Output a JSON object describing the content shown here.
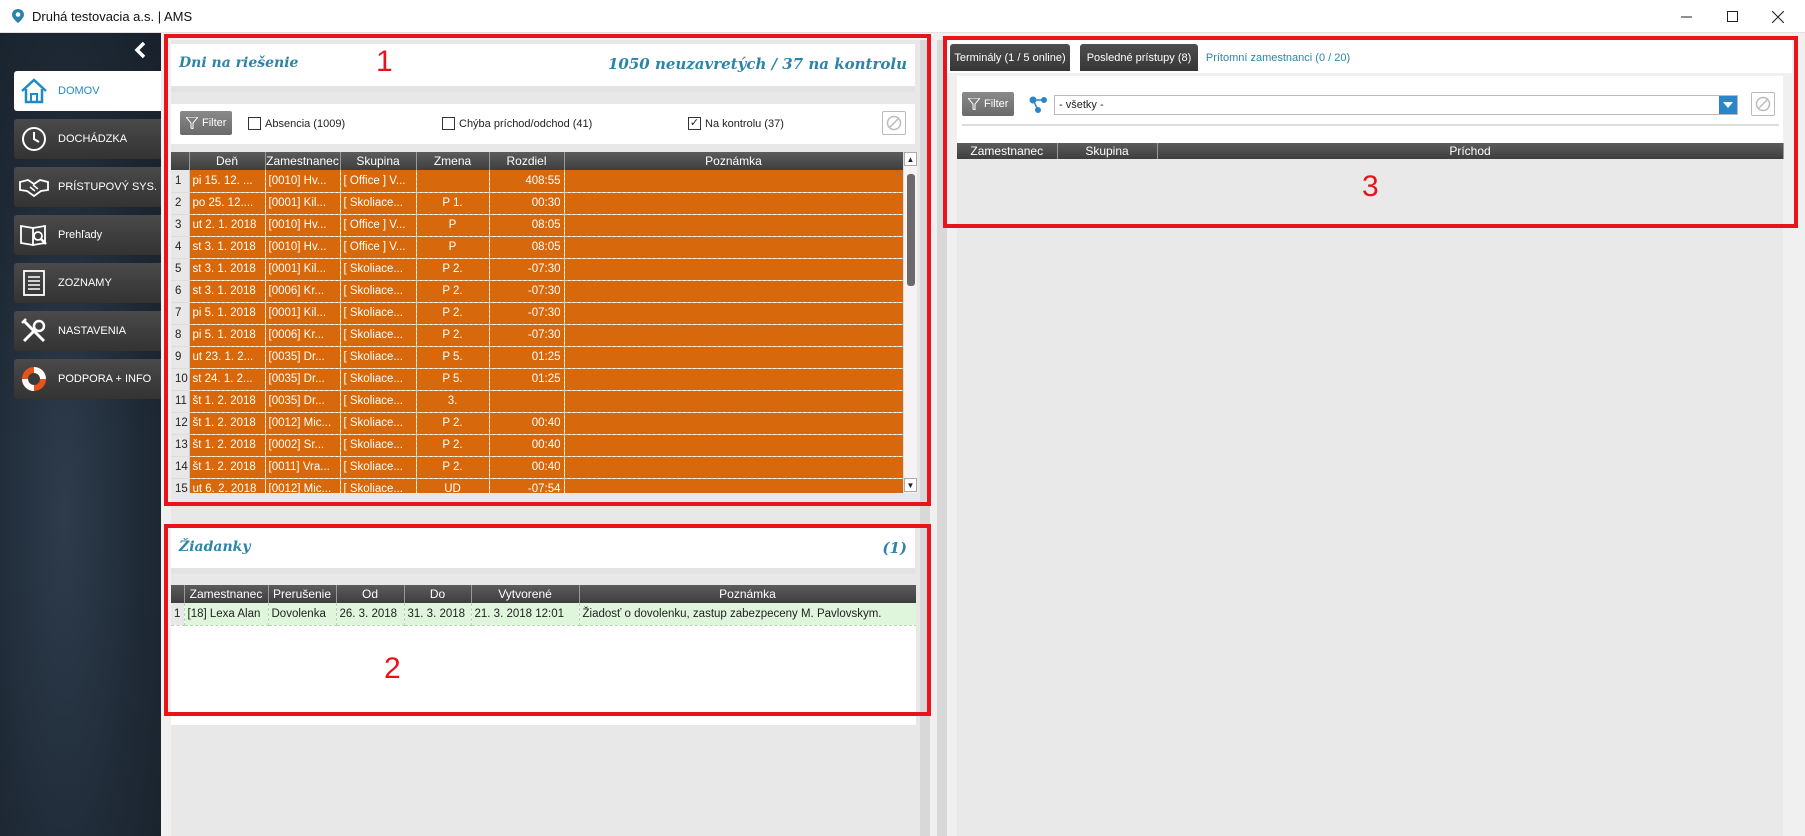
{
  "window": {
    "title": "Druhá testovacia a.s. | AMS"
  },
  "sidebar": {
    "items": [
      {
        "label": "DOMOV",
        "icon": "home-icon"
      },
      {
        "label": "DOCHÁDZKA",
        "icon": "clock-icon"
      },
      {
        "label": "PRÍSTUPOVÝ SYS.",
        "icon": "handshake-icon"
      },
      {
        "label": "Prehľady",
        "icon": "book-search-icon"
      },
      {
        "label": "ZOZNAMY",
        "icon": "list-icon"
      },
      {
        "label": "NASTAVENIA",
        "icon": "tools-icon"
      },
      {
        "label": "PODPORA + INFO",
        "icon": "lifebuoy-icon"
      }
    ]
  },
  "panel1": {
    "title": "Dni na riešenie",
    "count": "1050 neuzavretých / 37 na kontrolu",
    "filter_label": "Filter",
    "checkboxes": [
      {
        "label": "Absencia (1009)",
        "checked": false
      },
      {
        "label": "Chýba príchod/odchod (41)",
        "checked": false
      },
      {
        "label": "Na kontrolu (37)",
        "checked": true
      }
    ],
    "columns": [
      "Deň",
      "Zamestnanec",
      "Skupina",
      "Zmena",
      "Rozdiel",
      "Poznámka"
    ],
    "rows": [
      [
        "1",
        "pi 15. 12. ...",
        "[0010] Hv...",
        "[ Office ]  V...",
        "",
        "408:55",
        ""
      ],
      [
        "2",
        "po 25. 12....",
        "[0001] Kil...",
        "[ Skoliace...",
        "P 1.",
        "00:30",
        ""
      ],
      [
        "3",
        "ut 2. 1. 2018",
        "[0010] Hv...",
        "[ Office ]  V...",
        "P",
        "08:05",
        ""
      ],
      [
        "4",
        "st 3. 1. 2018",
        "[0010] Hv...",
        "[ Office ]  V...",
        "P",
        "08:05",
        ""
      ],
      [
        "5",
        "st 3. 1. 2018",
        "[0001] Kil...",
        "[ Skoliace...",
        "P 2.",
        "-07:30",
        ""
      ],
      [
        "6",
        "st 3. 1. 2018",
        "[0006] Kr...",
        "[ Skoliace...",
        "P 2.",
        "-07:30",
        ""
      ],
      [
        "7",
        "pi 5. 1. 2018",
        "[0001] Kil...",
        "[ Skoliace...",
        "P 2.",
        "-07:30",
        ""
      ],
      [
        "8",
        "pi 5. 1. 2018",
        "[0006] Kr...",
        "[ Skoliace...",
        "P 2.",
        "-07:30",
        ""
      ],
      [
        "9",
        "ut 23. 1. 2...",
        "[0035] Dr...",
        "[ Skoliace...",
        "P 5.",
        "01:25",
        ""
      ],
      [
        "10",
        "st 24. 1. 2...",
        "[0035] Dr...",
        "[ Skoliace...",
        "P 5.",
        "01:25",
        ""
      ],
      [
        "11",
        "št 1. 2. 2018",
        "[0035] Dr...",
        "[ Skoliace...",
        "3.",
        "",
        ""
      ],
      [
        "12",
        "št 1. 2. 2018",
        "[0012] Mic...",
        "[ Skoliace...",
        "P 2.",
        "00:40",
        ""
      ],
      [
        "13",
        "št 1. 2. 2018",
        "[0002] Sr...",
        "[ Skoliace...",
        "P 2.",
        "00:40",
        ""
      ],
      [
        "14",
        "št 1. 2. 2018",
        "[0011] Vra...",
        "[ Skoliace...",
        "P 2.",
        "00:40",
        ""
      ],
      [
        "15",
        "ut 6. 2. 2018",
        "[0012] Mic...",
        "[ Skoliace...",
        "UD",
        "-07:54",
        ""
      ]
    ]
  },
  "panel2": {
    "title": "Žiadanky",
    "count": "(1)",
    "columns": [
      "Zamestnanec",
      "Prerušenie",
      "Od",
      "Do",
      "Vytvorené",
      "Poznámka"
    ],
    "rows": [
      [
        "1",
        "[18] Lexa Alan",
        "Dovolenka",
        "26. 3. 2018",
        "31. 3. 2018",
        "21. 3. 2018  12:01",
        "Žiadosť o dovolenku, zastup zabezpeceny M. Pavlovskym."
      ]
    ]
  },
  "panel3": {
    "tabs": [
      {
        "label": "Terminály (1 / 5 online)",
        "active": false
      },
      {
        "label": "Posledné prístupy (8)",
        "active": false
      },
      {
        "label": "Prítomní zamestnanci (0 / 20)",
        "active": true
      }
    ],
    "filter_label": "Filter",
    "group_value": "- všetky -",
    "columns": [
      "Zamestnanec",
      "Skupina",
      "Príchod"
    ]
  },
  "annotations": {
    "box1": "1",
    "box2": "2",
    "box3": "3"
  },
  "colors": {
    "accent": "#2e84a8",
    "row_orange": "#d7680b",
    "row_green": "#dff6dc",
    "annotation_red": "#e8141a"
  }
}
